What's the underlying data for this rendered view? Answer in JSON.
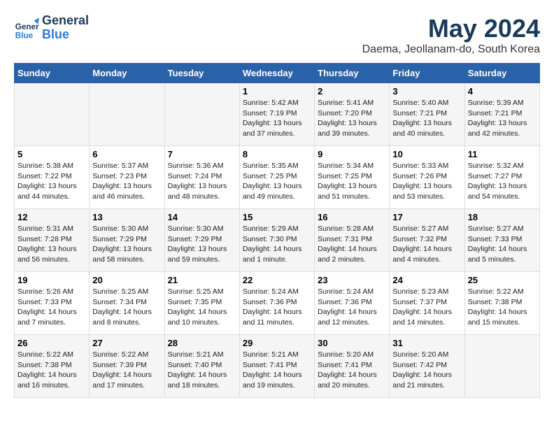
{
  "header": {
    "logo_line1": "General",
    "logo_line2": "Blue",
    "title": "May 2024",
    "subtitle": "Daema, Jeollanam-do, South Korea"
  },
  "weekdays": [
    "Sunday",
    "Monday",
    "Tuesday",
    "Wednesday",
    "Thursday",
    "Friday",
    "Saturday"
  ],
  "weeks": [
    [
      {
        "day": "",
        "info": ""
      },
      {
        "day": "",
        "info": ""
      },
      {
        "day": "",
        "info": ""
      },
      {
        "day": "1",
        "info": "Sunrise: 5:42 AM\nSunset: 7:19 PM\nDaylight: 13 hours\nand 37 minutes."
      },
      {
        "day": "2",
        "info": "Sunrise: 5:41 AM\nSunset: 7:20 PM\nDaylight: 13 hours\nand 39 minutes."
      },
      {
        "day": "3",
        "info": "Sunrise: 5:40 AM\nSunset: 7:21 PM\nDaylight: 13 hours\nand 40 minutes."
      },
      {
        "day": "4",
        "info": "Sunrise: 5:39 AM\nSunset: 7:21 PM\nDaylight: 13 hours\nand 42 minutes."
      }
    ],
    [
      {
        "day": "5",
        "info": "Sunrise: 5:38 AM\nSunset: 7:22 PM\nDaylight: 13 hours\nand 44 minutes."
      },
      {
        "day": "6",
        "info": "Sunrise: 5:37 AM\nSunset: 7:23 PM\nDaylight: 13 hours\nand 46 minutes."
      },
      {
        "day": "7",
        "info": "Sunrise: 5:36 AM\nSunset: 7:24 PM\nDaylight: 13 hours\nand 48 minutes."
      },
      {
        "day": "8",
        "info": "Sunrise: 5:35 AM\nSunset: 7:25 PM\nDaylight: 13 hours\nand 49 minutes."
      },
      {
        "day": "9",
        "info": "Sunrise: 5:34 AM\nSunset: 7:25 PM\nDaylight: 13 hours\nand 51 minutes."
      },
      {
        "day": "10",
        "info": "Sunrise: 5:33 AM\nSunset: 7:26 PM\nDaylight: 13 hours\nand 53 minutes."
      },
      {
        "day": "11",
        "info": "Sunrise: 5:32 AM\nSunset: 7:27 PM\nDaylight: 13 hours\nand 54 minutes."
      }
    ],
    [
      {
        "day": "12",
        "info": "Sunrise: 5:31 AM\nSunset: 7:28 PM\nDaylight: 13 hours\nand 56 minutes."
      },
      {
        "day": "13",
        "info": "Sunrise: 5:30 AM\nSunset: 7:29 PM\nDaylight: 13 hours\nand 58 minutes."
      },
      {
        "day": "14",
        "info": "Sunrise: 5:30 AM\nSunset: 7:29 PM\nDaylight: 13 hours\nand 59 minutes."
      },
      {
        "day": "15",
        "info": "Sunrise: 5:29 AM\nSunset: 7:30 PM\nDaylight: 14 hours\nand 1 minute."
      },
      {
        "day": "16",
        "info": "Sunrise: 5:28 AM\nSunset: 7:31 PM\nDaylight: 14 hours\nand 2 minutes."
      },
      {
        "day": "17",
        "info": "Sunrise: 5:27 AM\nSunset: 7:32 PM\nDaylight: 14 hours\nand 4 minutes."
      },
      {
        "day": "18",
        "info": "Sunrise: 5:27 AM\nSunset: 7:33 PM\nDaylight: 14 hours\nand 5 minutes."
      }
    ],
    [
      {
        "day": "19",
        "info": "Sunrise: 5:26 AM\nSunset: 7:33 PM\nDaylight: 14 hours\nand 7 minutes."
      },
      {
        "day": "20",
        "info": "Sunrise: 5:25 AM\nSunset: 7:34 PM\nDaylight: 14 hours\nand 8 minutes."
      },
      {
        "day": "21",
        "info": "Sunrise: 5:25 AM\nSunset: 7:35 PM\nDaylight: 14 hours\nand 10 minutes."
      },
      {
        "day": "22",
        "info": "Sunrise: 5:24 AM\nSunset: 7:36 PM\nDaylight: 14 hours\nand 11 minutes."
      },
      {
        "day": "23",
        "info": "Sunrise: 5:24 AM\nSunset: 7:36 PM\nDaylight: 14 hours\nand 12 minutes."
      },
      {
        "day": "24",
        "info": "Sunrise: 5:23 AM\nSunset: 7:37 PM\nDaylight: 14 hours\nand 14 minutes."
      },
      {
        "day": "25",
        "info": "Sunrise: 5:22 AM\nSunset: 7:38 PM\nDaylight: 14 hours\nand 15 minutes."
      }
    ],
    [
      {
        "day": "26",
        "info": "Sunrise: 5:22 AM\nSunset: 7:38 PM\nDaylight: 14 hours\nand 16 minutes."
      },
      {
        "day": "27",
        "info": "Sunrise: 5:22 AM\nSunset: 7:39 PM\nDaylight: 14 hours\nand 17 minutes."
      },
      {
        "day": "28",
        "info": "Sunrise: 5:21 AM\nSunset: 7:40 PM\nDaylight: 14 hours\nand 18 minutes."
      },
      {
        "day": "29",
        "info": "Sunrise: 5:21 AM\nSunset: 7:41 PM\nDaylight: 14 hours\nand 19 minutes."
      },
      {
        "day": "30",
        "info": "Sunrise: 5:20 AM\nSunset: 7:41 PM\nDaylight: 14 hours\nand 20 minutes."
      },
      {
        "day": "31",
        "info": "Sunrise: 5:20 AM\nSunset: 7:42 PM\nDaylight: 14 hours\nand 21 minutes."
      },
      {
        "day": "",
        "info": ""
      }
    ]
  ]
}
